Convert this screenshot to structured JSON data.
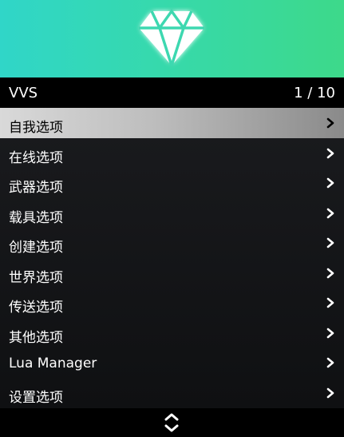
{
  "header": {
    "title": "VVS",
    "page_indicator": "1 / 10"
  },
  "banner": {
    "icon": "diamond-icon",
    "gradient_start": "#30d6c8",
    "gradient_end": "#3dd98a"
  },
  "menu": {
    "selected_index": 0,
    "items": [
      {
        "label": "自我选项",
        "icon": "chevron-right-icon"
      },
      {
        "label": "在线选项",
        "icon": "chevron-right-icon"
      },
      {
        "label": "武器选项",
        "icon": "chevron-right-icon"
      },
      {
        "label": "载具选项",
        "icon": "chevron-right-icon"
      },
      {
        "label": "创建选项",
        "icon": "chevron-right-icon"
      },
      {
        "label": "世界选项",
        "icon": "chevron-right-icon"
      },
      {
        "label": "传送选项",
        "icon": "chevron-right-icon"
      },
      {
        "label": "其他选项",
        "icon": "chevron-right-icon"
      },
      {
        "label": "Lua Manager",
        "icon": "chevron-right-icon"
      },
      {
        "label": "设置选项",
        "icon": "chevron-right-icon"
      }
    ]
  },
  "footer": {
    "icon": "scroll-up-down-icon"
  }
}
